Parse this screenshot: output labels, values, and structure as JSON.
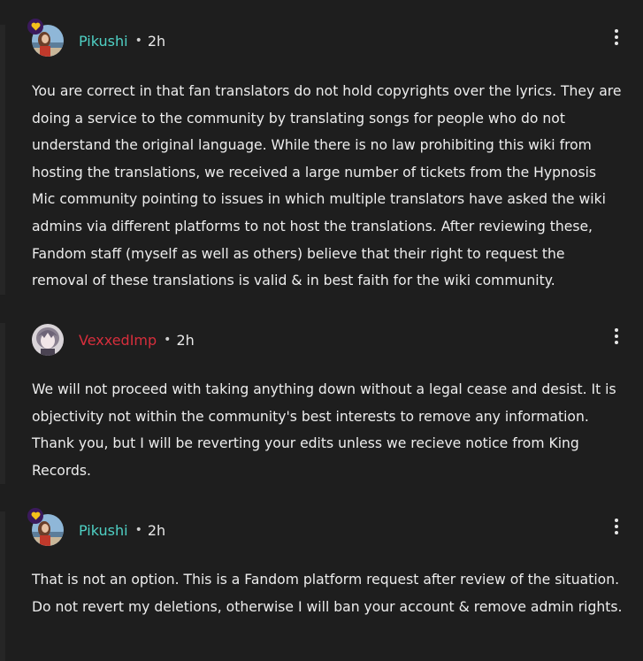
{
  "colors": {
    "background": "#1e1e1e",
    "staff_name": "#4fd1c5",
    "user_name": "#d62e3c",
    "text": "#ededed"
  },
  "replies": [
    {
      "username": "Pikushi",
      "separator": "•",
      "time": "2h",
      "staff_badge_icon": "heart-icon",
      "menu_icon": "kebab-menu-icon",
      "text": "You are correct in that fan translators do not hold copyrights over the lyrics. They are doing a service to the community by translating songs for people who do not understand the original language. While there is no law prohibiting this wiki from hosting the translations, we received a large number of tickets from the Hypnosis Mic community pointing to issues in which multiple translators have asked the wiki admins via different platforms to not host the translations. After reviewing these, Fandom staff (myself as well as others) believe that their right to request the removal of these translations is valid & in best faith for the wiki community."
    },
    {
      "username": "VexxedImp",
      "separator": "•",
      "time": "2h",
      "menu_icon": "kebab-menu-icon",
      "text": "We will not proceed with taking anything down without a legal cease and desist. It is objectivity not within the community's best interests to remove any information. Thank you, but I will be reverting your edits unless we recieve notice from King Records."
    },
    {
      "username": "Pikushi",
      "separator": "•",
      "time": "2h",
      "staff_badge_icon": "heart-icon",
      "menu_icon": "kebab-menu-icon",
      "text": "That is not an option. This is a Fandom platform request after review of the situation. Do not revert my deletions, otherwise I will ban your account & remove admin rights."
    }
  ]
}
